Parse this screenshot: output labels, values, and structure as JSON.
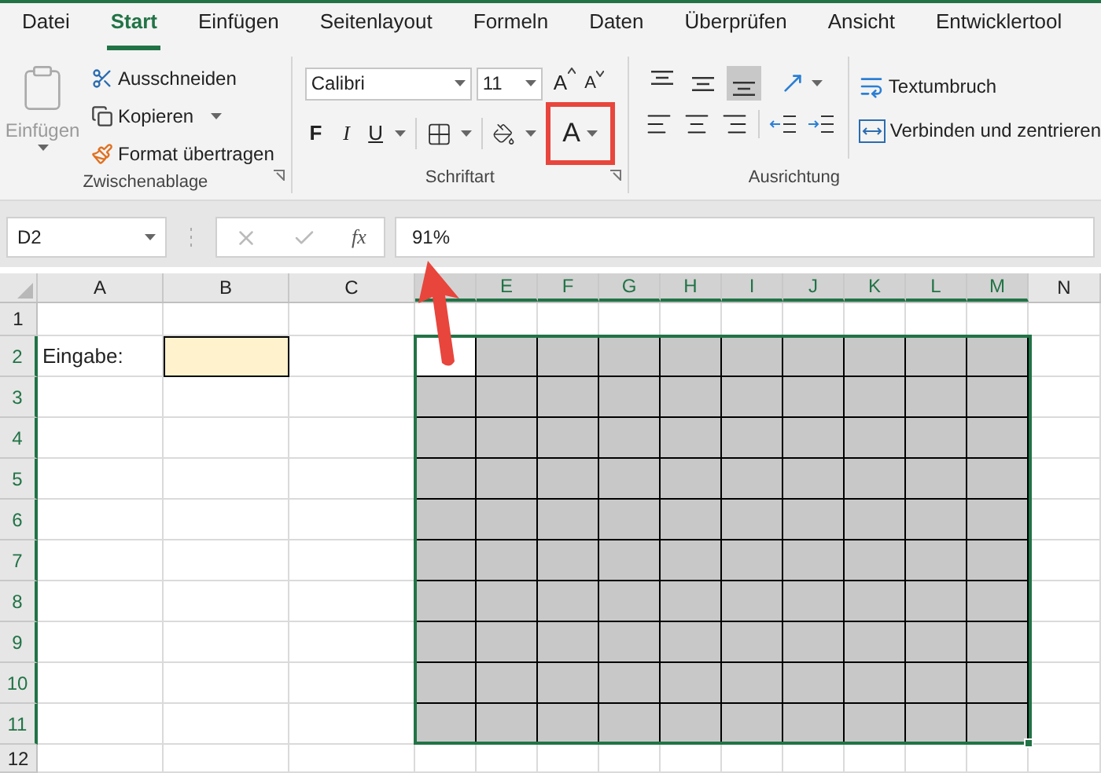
{
  "ribbon_tabs": [
    {
      "label": "Datei",
      "selected": false
    },
    {
      "label": "Start",
      "selected": true
    },
    {
      "label": "Einfügen",
      "selected": false
    },
    {
      "label": "Seitenlayout",
      "selected": false
    },
    {
      "label": "Formeln",
      "selected": false
    },
    {
      "label": "Daten",
      "selected": false
    },
    {
      "label": "Überprüfen",
      "selected": false
    },
    {
      "label": "Ansicht",
      "selected": false
    },
    {
      "label": "Entwicklertool",
      "selected": false
    }
  ],
  "clipboard": {
    "paste": {
      "label": "Einfügen",
      "disabled": true
    },
    "cut": "Ausschneiden",
    "copy": "Kopieren",
    "format_painter": "Format übertragen",
    "group_label": "Zwischenablage"
  },
  "font": {
    "name": "Calibri",
    "size": "11",
    "grow": "A",
    "shrink": "A",
    "bold": "F",
    "italic": "I",
    "underline": "U",
    "color_button": {
      "label": "A",
      "highlighted": true
    },
    "group_label": "Schriftart"
  },
  "alignment": {
    "vertical": [
      {
        "selected": false
      },
      {
        "selected": false
      },
      {
        "selected": true
      }
    ],
    "wrap": "Textumbruch",
    "merge": "Verbinden und zentrieren",
    "group_label": "Ausrichtung"
  },
  "name_box": "D2",
  "function_button": "fx",
  "formula": "91%",
  "columns": [
    {
      "label": "A",
      "selected": false
    },
    {
      "label": "B",
      "selected": false
    },
    {
      "label": "C",
      "selected": false
    },
    {
      "selected": true
    },
    {
      "label": "E",
      "selected": true
    },
    {
      "label": "F",
      "selected": true
    },
    {
      "label": "G",
      "selected": true
    },
    {
      "label": "H",
      "selected": true
    },
    {
      "label": "I",
      "selected": true
    },
    {
      "label": "J",
      "selected": true
    },
    {
      "label": "K",
      "selected": true
    },
    {
      "label": "L",
      "selected": true
    },
    {
      "label": "M",
      "selected": true
    },
    {
      "label": "N",
      "selected": false
    }
  ],
  "rows": [
    {
      "label": "1",
      "selected": false
    },
    {
      "label": "2",
      "selected": true
    },
    {
      "label": "3",
      "selected": true
    },
    {
      "label": "4",
      "selected": true
    },
    {
      "label": "5",
      "selected": true
    },
    {
      "label": "6",
      "selected": true
    },
    {
      "label": "7",
      "selected": true
    },
    {
      "label": "8",
      "selected": true
    },
    {
      "label": "9",
      "selected": true
    },
    {
      "label": "10",
      "selected": true
    },
    {
      "label": "11",
      "selected": true
    },
    {
      "label": "12",
      "selected": false
    }
  ],
  "input_label": "Eingabe:",
  "grid": [
    [
      false,
      true,
      true,
      true,
      true,
      true,
      true,
      true,
      true,
      true
    ],
    [
      true,
      true,
      true,
      true,
      true,
      true,
      true,
      true,
      true,
      true
    ],
    [
      true,
      true,
      true,
      true,
      true,
      true,
      true,
      true,
      true,
      true
    ],
    [
      true,
      true,
      true,
      true,
      true,
      true,
      true,
      true,
      true,
      true
    ],
    [
      true,
      true,
      true,
      true,
      true,
      true,
      true,
      true,
      true,
      true
    ],
    [
      true,
      true,
      true,
      true,
      true,
      true,
      true,
      true,
      true,
      true
    ],
    [
      true,
      true,
      true,
      true,
      true,
      true,
      true,
      true,
      true,
      true
    ],
    [
      true,
      true,
      true,
      true,
      true,
      true,
      true,
      true,
      true,
      true
    ],
    [
      true,
      true,
      true,
      true,
      true,
      true,
      true,
      true,
      true,
      true
    ],
    [
      true,
      true,
      true,
      true,
      true,
      true,
      true,
      true,
      true,
      true
    ]
  ]
}
